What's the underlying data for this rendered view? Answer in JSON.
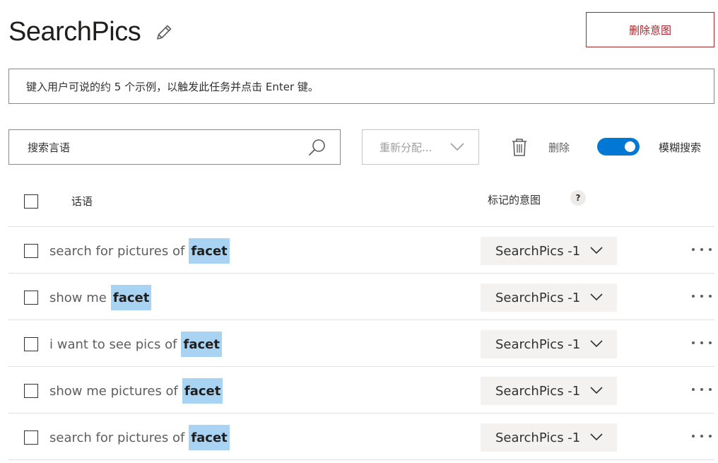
{
  "page": {
    "title": "SearchPics",
    "delete_intent_label": "删除意图"
  },
  "utterance_input": {
    "placeholder": "键入用户可说的约 5 个示例，以触发此任务并点击 Enter 键。"
  },
  "toolbar": {
    "search_placeholder": "搜索言语",
    "reassign_label": "重新分配...",
    "delete_label": "删除",
    "fuzzy_search_label": "模糊搜索",
    "fuzzy_search_on": true
  },
  "table": {
    "header_utterance": "话语",
    "header_intent": "标记的意图",
    "help_glyph": "?",
    "rows": [
      {
        "prefix": "search for pictures of",
        "entity": "facet",
        "intent": "SearchPics -1"
      },
      {
        "prefix": "show me",
        "entity": "facet",
        "intent": "SearchPics -1"
      },
      {
        "prefix": "i want to see pics of",
        "entity": "facet",
        "intent": "SearchPics -1"
      },
      {
        "prefix": "show me pictures of",
        "entity": "facet",
        "intent": "SearchPics -1"
      },
      {
        "prefix": "search for pictures of",
        "entity": "facet",
        "intent": "SearchPics -1"
      }
    ]
  },
  "icons": {
    "edit": "pencil-icon",
    "search": "search-icon",
    "reassign": "chevron-down-icon",
    "delete": "trash-icon",
    "more": "more-icon"
  },
  "colors": {
    "accent": "#0078d4",
    "danger": "#a4262c",
    "entity_highlight": "#a9d3f2"
  }
}
